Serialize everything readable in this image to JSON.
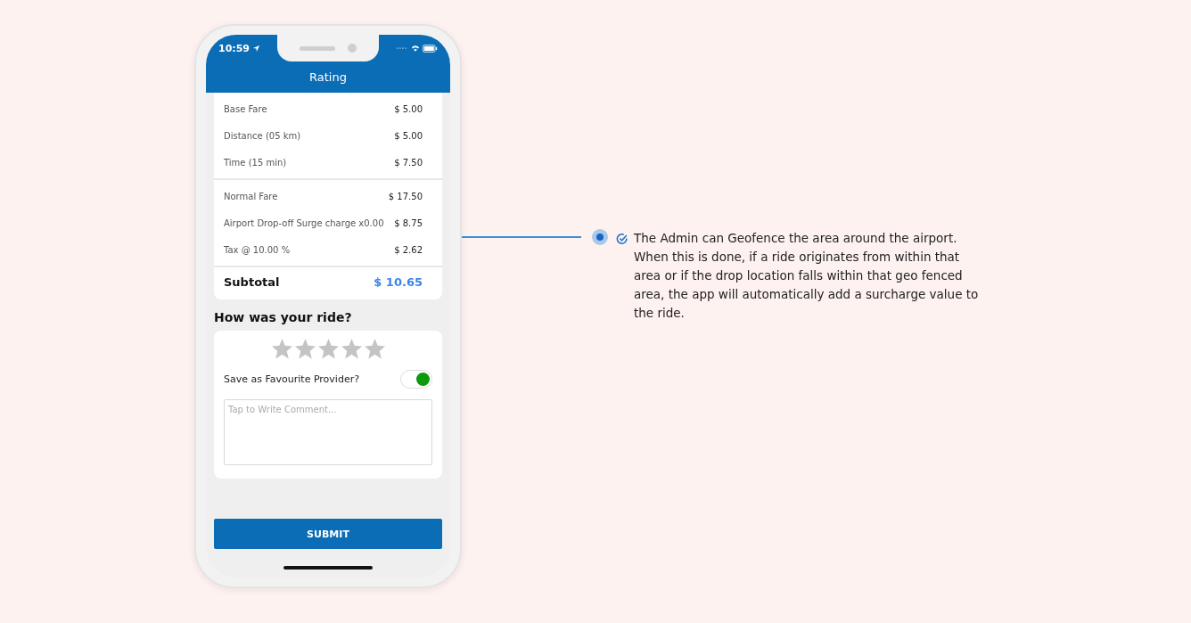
{
  "status_bar": {
    "time": "10:59"
  },
  "header": {
    "title": "Rating"
  },
  "fare": {
    "groups": [
      [
        {
          "label": "Base Fare",
          "value": "$ 5.00"
        },
        {
          "label": "Distance (05 km)",
          "value": "$ 5.00"
        },
        {
          "label": "Time (15 min)",
          "value": "$ 7.50"
        }
      ],
      [
        {
          "label": "Normal Fare",
          "value": "$ 17.50"
        },
        {
          "label": "Airport Drop-off Surge charge x0.00",
          "value": "$ 8.75"
        },
        {
          "label": "Tax @ 10.00 %",
          "value": "$ 2.62"
        }
      ]
    ],
    "subtotal": {
      "label": "Subtotal",
      "value": "$ 10.65"
    }
  },
  "rating": {
    "heading": "How was your ride?",
    "stars": 0,
    "favourite": {
      "label": "Save as Favourite Provider?",
      "on": true
    },
    "comment": {
      "placeholder": "Tap to Write Comment..."
    }
  },
  "submit": {
    "label": "SUBMIT"
  },
  "callout": {
    "text": "The Admin can Geofence the area around the airport. When this is done, if a ride originates from within that area or if the drop location falls within that geo fenced area, the app will automatically add a surcharge value to the ride."
  }
}
